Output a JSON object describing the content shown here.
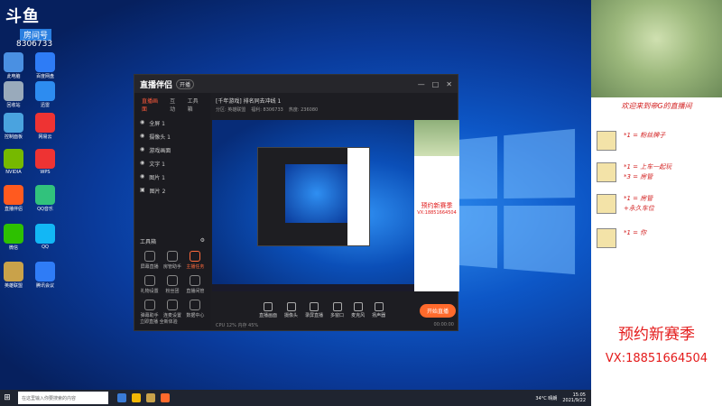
{
  "desktop": {
    "brand": "斗鱼",
    "brand_sub": "房间号",
    "brand_id": "8306733",
    "icons": [
      {
        "label": "此电脑",
        "color": "#4a90e2"
      },
      {
        "label": "百度网盘",
        "color": "#2e7cf6"
      },
      {
        "label": "回收站",
        "color": "#9ab"
      },
      {
        "label": "迅雷",
        "color": "#2d8cf0"
      },
      {
        "label": "控制面板",
        "color": "#4aa3df"
      },
      {
        "label": "网易云",
        "color": "#e33"
      },
      {
        "label": "NVIDIA",
        "color": "#76b900"
      },
      {
        "label": "WPS",
        "color": "#e33"
      },
      {
        "label": "直播伴侣",
        "color": "#ff5a1f"
      },
      {
        "label": "QQ音乐",
        "color": "#31c27c"
      },
      {
        "label": "微信",
        "color": "#2dc100"
      },
      {
        "label": "QQ",
        "color": "#12b7f5"
      },
      {
        "label": "英雄联盟",
        "color": "#c9a24a"
      },
      {
        "label": "腾讯会议",
        "color": "#2f7cf6"
      }
    ]
  },
  "app": {
    "title": "直播伴侣",
    "badge": "开播",
    "tabs": [
      "直播画面",
      "互动",
      "工具箱"
    ],
    "scenes": [
      "全屏 1",
      "摄像头 1",
      "游戏画面",
      "文字 1",
      "图片 1",
      "图片 2"
    ],
    "stream_title": "[千年游戏] 排名同去冲线 1",
    "stream_meta": [
      "分区: 英雄联盟",
      "福利: 8306733",
      "热度: 236080"
    ],
    "tools_header": "工具箱",
    "tools": [
      {
        "label": "屏幕直播",
        "hot": false
      },
      {
        "label": "房管助手",
        "hot": false
      },
      {
        "label": "主播任务",
        "hot": true
      },
      {
        "label": "礼物设置",
        "hot": false
      },
      {
        "label": "粉丝团",
        "hot": false
      },
      {
        "label": "直播间管",
        "hot": false
      },
      {
        "label": "弹幕助手",
        "hot": false
      },
      {
        "label": "连麦设置",
        "hot": false
      },
      {
        "label": "数据中心",
        "hot": false
      }
    ],
    "upgrade": "立即直播 全新体验",
    "controls": [
      "直播画面",
      "摄像头",
      "录屏直播",
      "多窗口",
      "麦克风",
      "扬声器"
    ],
    "start_live": "开始直播",
    "status_left": "CPU 12%  内存 45%",
    "status_right": "00:00:00",
    "promo": "预约新赛季",
    "promo_vx": "VX:18851664504"
  },
  "overlay": {
    "welcome": "欢迎来到帝G的直播间",
    "perks": [
      "*1 = 粉丝牌子",
      "*1 = 上车一起玩\n*3 = 房管",
      "*1 = 房管\n+永久车位",
      "*1 = 你"
    ],
    "new_season": "预约新赛季",
    "vx": "VX:18851664504"
  },
  "taskbar": {
    "search_placeholder": "在这里输入你要搜索的内容",
    "weather": "34°C 晴朗",
    "time": "15:05",
    "date": "2021/9/22"
  }
}
